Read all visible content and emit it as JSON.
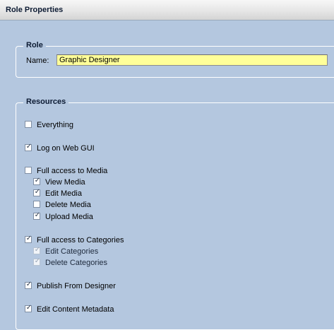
{
  "panel": {
    "title": "Role Properties"
  },
  "role": {
    "legend": "Role",
    "name_label": "Name:",
    "name_value": "Graphic Designer"
  },
  "resources": {
    "legend": "Resources",
    "items": [
      {
        "label": "Everything",
        "checked": false,
        "disabled": false
      },
      {
        "label": "Log on Web GUI",
        "checked": true,
        "disabled": false
      },
      {
        "label": "Full access to Media",
        "checked": false,
        "disabled": false
      },
      {
        "label": "View Media",
        "checked": true,
        "disabled": false
      },
      {
        "label": "Edit Media",
        "checked": true,
        "disabled": false
      },
      {
        "label": "Delete Media",
        "checked": false,
        "disabled": false
      },
      {
        "label": "Upload Media",
        "checked": true,
        "disabled": false
      },
      {
        "label": "Full access to Categories",
        "checked": true,
        "disabled": false
      },
      {
        "label": "Edit Categories",
        "checked": true,
        "disabled": true
      },
      {
        "label": "Delete Categories",
        "checked": true,
        "disabled": true
      },
      {
        "label": "Publish From Designer",
        "checked": true,
        "disabled": false
      },
      {
        "label": "Edit Content Metadata",
        "checked": true,
        "disabled": false
      }
    ]
  },
  "colors": {
    "background": "#b4c7df",
    "input_highlight": "#ffff99",
    "title_text": "#0d1b33"
  }
}
